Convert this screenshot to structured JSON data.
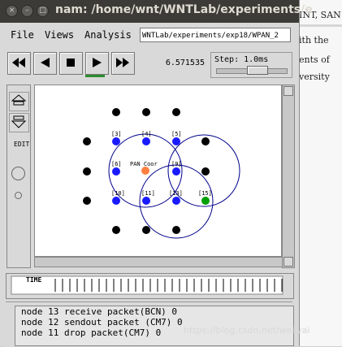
{
  "window": {
    "title": "nam: /home/wnt/WNTLab/experiments/e"
  },
  "menu": {
    "file": "File",
    "views": "Views",
    "analysis": "Analysis",
    "path": "WNTLab/experiments/exp18/WPAN_2"
  },
  "controls": {
    "time": "6.571535",
    "step_label": "Step: 1.0ms",
    "icons": [
      "rewind-icon",
      "back-icon",
      "stop-icon",
      "play-icon",
      "fast-forward-icon"
    ]
  },
  "tools": {
    "edit_label": "EDIT"
  },
  "canvas": {
    "pan_coord_label": "PAN Coor",
    "node_labels": [
      "[3]",
      "[4]",
      "[5]",
      "[6]",
      "[9]",
      "[10]",
      "[11]",
      "[13]",
      "[15]"
    ],
    "colors": {
      "coordinator": "#ff8040",
      "blue_node": "#1a1aff",
      "black_node": "#000000",
      "green_node": "#00a000",
      "range": "#00008b"
    }
  },
  "timeline": {
    "label": "TIME"
  },
  "log": {
    "lines": [
      "node 13 receive packet(BCN) 0",
      "node 12 sendout packet (CM7) 0",
      "node 11 drop packet(CM7) 0"
    ]
  },
  "background_document": {
    "lines": [
      "INT, SAN",
      "ith the",
      "ents of",
      "versity"
    ]
  },
  "watermark": "https://blog.csdn.net/weiwai"
}
